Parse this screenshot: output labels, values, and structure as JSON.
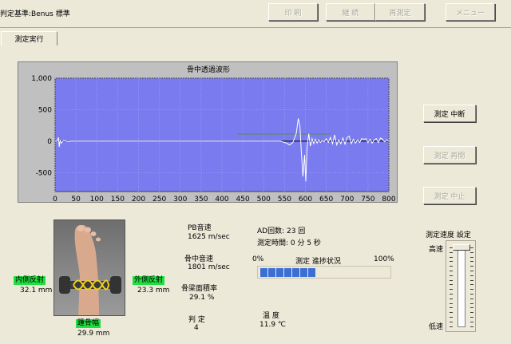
{
  "header": {
    "standard_label": "判定基準:Benus 標準",
    "buttons": {
      "print": "印 刷",
      "continue": "継 続",
      "remeasure": "再測定",
      "menu": "メニュー"
    }
  },
  "tab": {
    "label": "測定実行"
  },
  "chart_data": {
    "type": "line",
    "title": "骨中透過波形",
    "xlim": [
      0,
      800
    ],
    "ylim": [
      -800,
      1000
    ],
    "x_ticks": [
      "0",
      "50",
      "100",
      "150",
      "200",
      "250",
      "300",
      "350",
      "400",
      "450",
      "500",
      "550",
      "600",
      "650",
      "700",
      "750",
      "800"
    ],
    "y_ticks": [
      "1,000",
      "500",
      "0",
      "-500"
    ],
    "grid": true,
    "background_color": "#7b7bf0",
    "series_color": "#ffffff",
    "marker_line": {
      "x": [
        437,
        660
      ],
      "y": 115,
      "color": "#4c9a2a"
    },
    "waveform": {
      "x": [
        0,
        5,
        8,
        10,
        12,
        15,
        20,
        30,
        40,
        100,
        200,
        300,
        400,
        450,
        500,
        540,
        555,
        562,
        570,
        578,
        583,
        587,
        590,
        594,
        598,
        601,
        604,
        608,
        612,
        616,
        620,
        624,
        628,
        632,
        636,
        640,
        645,
        650,
        655,
        660,
        665,
        670,
        675,
        680,
        685,
        690,
        695,
        700,
        705,
        710,
        715,
        720,
        725,
        730,
        735,
        740,
        745,
        750,
        755,
        760,
        765,
        770,
        775,
        780,
        785,
        790,
        795,
        800
      ],
      "y": [
        0,
        0,
        60,
        -90,
        20,
        -30,
        10,
        -5,
        0,
        0,
        0,
        0,
        0,
        0,
        0,
        0,
        -30,
        -60,
        -20,
        120,
        360,
        230,
        -150,
        -560,
        -220,
        -640,
        -100,
        120,
        -80,
        40,
        -40,
        30,
        -30,
        20,
        -20,
        10,
        -10,
        40,
        -20,
        60,
        -40,
        100,
        -60,
        20,
        -40,
        50,
        -50,
        60,
        80,
        -40,
        30,
        -30,
        20,
        -20,
        40,
        30,
        40,
        -20,
        30,
        -30,
        20,
        40,
        -20,
        50,
        30,
        -10,
        20,
        0
      ]
    },
    "series": [
      {
        "values_ref": "waveform"
      }
    ]
  },
  "side_buttons": {
    "pause": "測定 中断",
    "resume": "測定 再開",
    "stop": "測定 中止"
  },
  "foot": {
    "inner_label": "内側反射",
    "inner_value": "32.1 mm",
    "outer_label": "外側反射",
    "outer_value": "23.3 mm",
    "heel_label": "踵骨幅",
    "heel_value": "29.9 mm"
  },
  "measurements": {
    "pb_label": "PB音速",
    "pb_value": "1625 m/sec",
    "bone_label": "骨中音速",
    "bone_value": "1801 m/sec",
    "area_label": "骨梁面積率",
    "area_value": "29.1 %",
    "judge_label": "判 定",
    "judge_value": "4",
    "ad_count": "AD回数: 23 回",
    "time": "測定時間: 0 分 5 秒",
    "temp_label": "温 度",
    "temp_value": "11.9 ℃"
  },
  "progress": {
    "left_label": "0%",
    "title": "測定 進捗状況",
    "right_label": "100%",
    "segments_filled": 7,
    "value_fraction": 0.42,
    "color": "#3c6fd4"
  },
  "speed": {
    "title": "測定速度 設定",
    "high": "高速",
    "low": "低速",
    "level_fraction": 1.0
  }
}
